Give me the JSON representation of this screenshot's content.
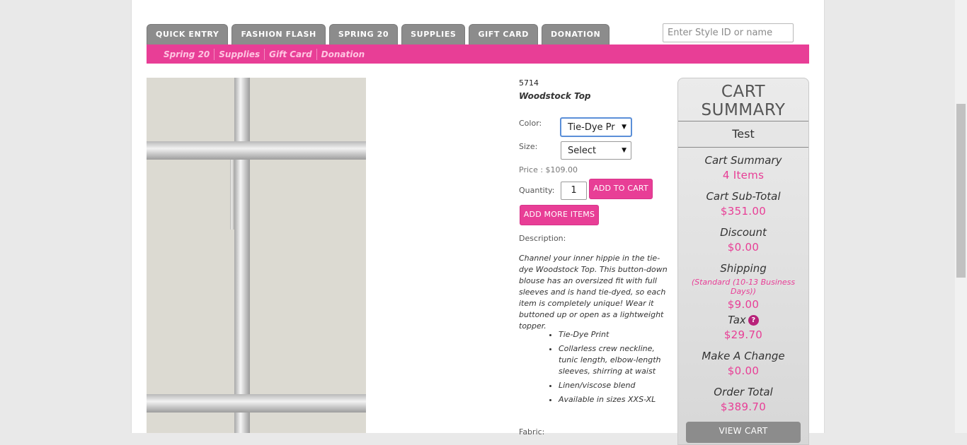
{
  "tabs": [
    {
      "label": "QUICK ENTRY"
    },
    {
      "label": "FASHION FLASH"
    },
    {
      "label": "SPRING 20"
    },
    {
      "label": "SUPPLIES"
    },
    {
      "label": "GIFT CARD"
    },
    {
      "label": "DONATION"
    }
  ],
  "search": {
    "placeholder": "Enter Style ID or name",
    "value": ""
  },
  "subnav": [
    {
      "label": "Spring 20"
    },
    {
      "label": "Supplies"
    },
    {
      "label": "Gift Card"
    },
    {
      "label": "Donation"
    }
  ],
  "product": {
    "style_id": "5714",
    "name": "Woodstock Top",
    "color_label": "Color:",
    "color_value": "Tie-Dye Pr",
    "size_label": "Size:",
    "size_value": "Select",
    "price": "Price : $109.00",
    "quantity_label": "Quantity:",
    "quantity_value": "1",
    "add_to_cart": "ADD TO CART",
    "add_more_items": "ADD MORE ITEMS",
    "description_label": "Description:",
    "description": "Channel your inner hippie in the tie-dye Woodstock Top. This button-down blouse has an oversized fit with full sleeves and is hand tie-dyed, so each item is completely unique! Wear it buttoned up or open as a lightweight topper.",
    "features": [
      "Tie-Dye Print",
      "Collarless crew neckline, tunic length, elbow-length sleeves, shirring at waist",
      "Linen/viscose blend",
      "Available in sizes XXS-XL"
    ],
    "fabric_label": "Fabric:"
  },
  "cart": {
    "title": "CART SUMMARY",
    "user": "Test",
    "summary_label": "Cart Summary",
    "items": "4 Items",
    "subtotal_label": "Cart Sub-Total",
    "subtotal": "$351.00",
    "discount_label": "Discount",
    "discount": "$0.00",
    "shipping_label": "Shipping",
    "shipping_note": "(Standard (10-13 Business Days))",
    "shipping": "$9.00",
    "tax_label": "Tax",
    "tax": "$29.70",
    "change_label": "Make A Change",
    "change": "$0.00",
    "total_label": "Order Total",
    "total": "$389.70",
    "view_cart": "VIEW CART"
  },
  "icons": {
    "help": "question-mark-icon",
    "dropdown": "chevron-down-icon"
  },
  "colors": {
    "accent": "#e83e96",
    "tab": "#8c8c8c"
  }
}
